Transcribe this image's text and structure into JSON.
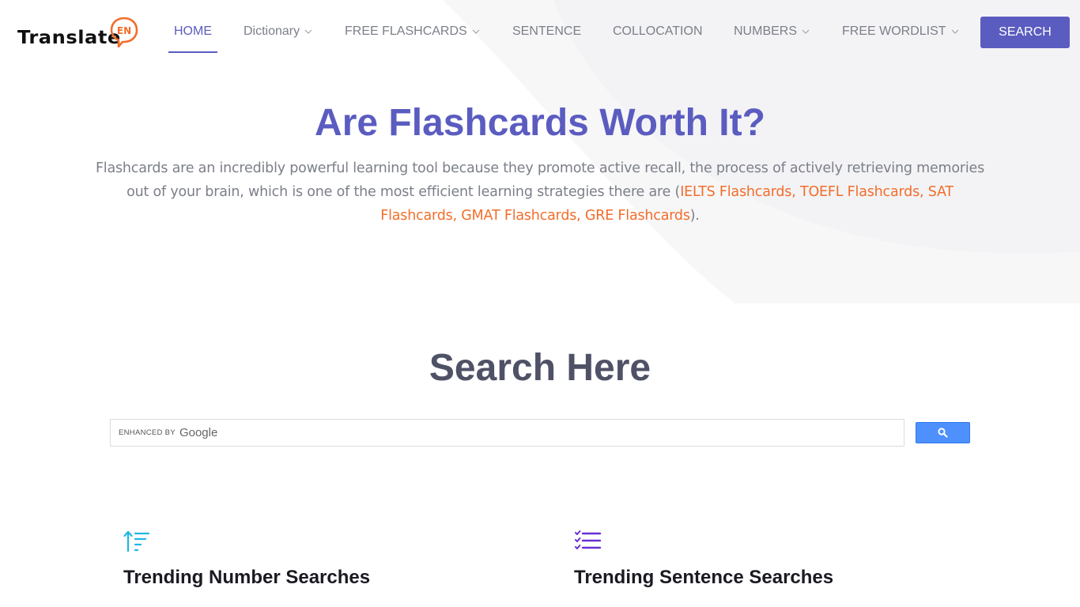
{
  "brand": {
    "logo_text": "Translate",
    "logo_badge": "EN",
    "accent_color": "#5b5cc0",
    "logo_orange": "#f26d2a"
  },
  "nav": {
    "items": [
      {
        "label": "HOME",
        "active": true,
        "dropdown": false
      },
      {
        "label": "Dictionary",
        "active": false,
        "dropdown": true
      },
      {
        "label": "FREE FLASHCARDS",
        "active": false,
        "dropdown": true
      },
      {
        "label": "SENTENCE",
        "active": false,
        "dropdown": false
      },
      {
        "label": "COLLOCATION",
        "active": false,
        "dropdown": false
      },
      {
        "label": "NUMBERS",
        "active": false,
        "dropdown": true
      },
      {
        "label": "FREE WORDLIST",
        "active": false,
        "dropdown": true
      }
    ],
    "search_button": "SEARCH"
  },
  "hero": {
    "title": "Are Flashcards Worth It?",
    "text_before": "Flashcards are an incredibly powerful learning tool because they promote active recall, the process of actively retrieving memories out of your brain, which is one of the most efficient learning strategies there are (",
    "links": [
      "IELTS Flashcards",
      "TOEFL Flashcards",
      "SAT Flashcards",
      "GMAT Flashcards",
      "GRE Flashcards"
    ],
    "separator": ", ",
    "text_after": ").",
    "link_color": "#f26d2a"
  },
  "search_section": {
    "title": "Search Here",
    "enhanced_by": "ENHANCED BY",
    "google": "Google",
    "button_icon": "search-icon"
  },
  "features": [
    {
      "icon": "sort-ascending-icon",
      "title": "Trending Number Searches",
      "icon_color": "#1fb6e6"
    },
    {
      "icon": "checklist-icon",
      "title": "Trending Sentence Searches",
      "icon_color": "#6a2fd6"
    }
  ]
}
